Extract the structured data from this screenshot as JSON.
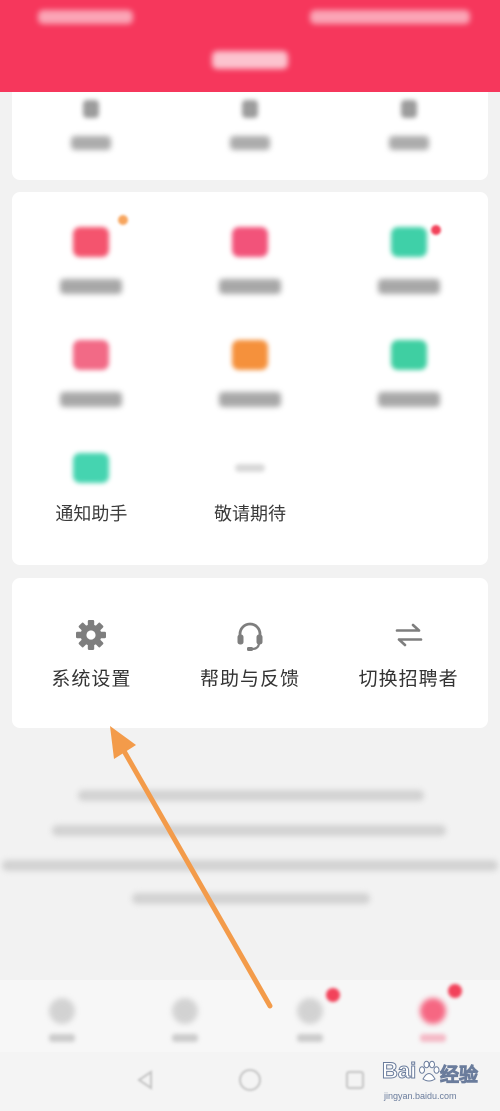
{
  "theme": {
    "header_bg": "#f6375c",
    "page_bg": "#f2f2f2",
    "card_bg": "#ffffff",
    "text": "#333333",
    "arrow": "#f39b4a"
  },
  "grid": {
    "items": [
      {
        "icon": "app-icon",
        "color": "#f4546e",
        "badge": "#f7a55e"
      },
      {
        "icon": "app-icon",
        "color": "#f2537a"
      },
      {
        "icon": "app-icon",
        "color": "#3fd0a8",
        "badge": "#f2425a"
      },
      {
        "icon": "app-icon",
        "color": "#f26a86"
      },
      {
        "icon": "folder-icon",
        "color": "#f5913c"
      },
      {
        "icon": "app-icon",
        "color": "#3fcfa2"
      },
      {
        "icon": "app-icon",
        "color": "#45d4b0",
        "label": "通知助手"
      },
      {
        "icon": "placeholder-icon",
        "color": "#d8d8d8",
        "label": "敬请期待"
      }
    ]
  },
  "actions": {
    "items": [
      {
        "icon": "gear-icon",
        "label": "系统设置"
      },
      {
        "icon": "headset-icon",
        "label": "帮助与反馈"
      },
      {
        "icon": "swap-icon",
        "label": "切换招聘者"
      }
    ]
  },
  "tab_bar": {
    "items": [
      {
        "icon": "tab-icon",
        "color": "#b5b5b5"
      },
      {
        "icon": "tab-icon",
        "color": "#b5b5b5"
      },
      {
        "icon": "tab-icon",
        "color": "#b5b5b5",
        "badge": "#f2425a"
      },
      {
        "icon": "tab-icon",
        "color": "#f6375c",
        "badge": "#f2425a"
      }
    ]
  },
  "nav_bar": {
    "items": [
      {
        "icon": "back-icon"
      },
      {
        "icon": "home-icon"
      },
      {
        "icon": "recents-icon"
      }
    ]
  },
  "watermark": {
    "brand_text": "Bai",
    "brand_suffix": "经验",
    "url": "jingyan.baidu.com"
  }
}
